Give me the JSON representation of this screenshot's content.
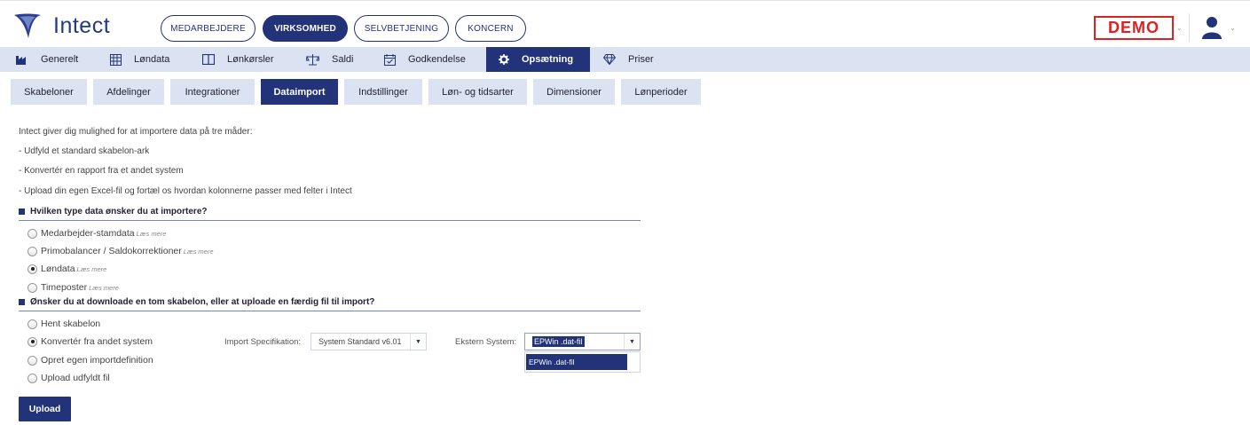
{
  "app": {
    "logo_text": "Intect"
  },
  "top_tabs": [
    {
      "label": "MEDARBEJDERE",
      "active": false
    },
    {
      "label": "VIRKSOMHED",
      "active": true
    },
    {
      "label": "SELVBETJENING",
      "active": false
    },
    {
      "label": "KONCERN",
      "active": false
    }
  ],
  "demo_badge": "DEMO",
  "main_nav": [
    {
      "label": "Generelt",
      "icon": "factory-icon"
    },
    {
      "label": "Løndata",
      "icon": "table-icon"
    },
    {
      "label": "Lønkørsler",
      "icon": "book-icon"
    },
    {
      "label": "Saldi",
      "icon": "scale-icon"
    },
    {
      "label": "Godkendelse",
      "icon": "calendar-check-icon"
    },
    {
      "label": "Opsætning",
      "icon": "gear-icon",
      "active": true
    },
    {
      "label": "Priser",
      "icon": "diamond-icon"
    }
  ],
  "sub_nav": [
    {
      "label": "Skabeloner"
    },
    {
      "label": "Afdelinger"
    },
    {
      "label": "Integrationer"
    },
    {
      "label": "Dataimport",
      "active": true
    },
    {
      "label": "Indstillinger"
    },
    {
      "label": "Løn- og tidsarter"
    },
    {
      "label": "Dimensioner"
    },
    {
      "label": "Lønperioder"
    }
  ],
  "intro": {
    "line1": "Intect giver dig mulighed for at importere data på tre måder:",
    "line2": "- Udfyld et standard skabelon-ark",
    "line3": "- Konvertér en rapport fra et andet system",
    "line4": "- Upload din egen Excel-fil og fortæl os hvordan kolonnerne passer med felter i Intect"
  },
  "section1": {
    "title": "Hvilken type data ønsker du at importere?",
    "options": [
      {
        "label": "Medarbejder-stamdata",
        "link": "Læs mere",
        "checked": false
      },
      {
        "label": "Primobalancer / Saldokorrektioner",
        "link": "Læs mere",
        "checked": false
      },
      {
        "label": "Løndata",
        "link": "Læs mere",
        "checked": true
      },
      {
        "label": "Timeposter",
        "link": "Læs mere",
        "checked": false
      }
    ]
  },
  "section2": {
    "title": "Ønsker du at downloade en tom skabelon, eller at uploade en færdig fil til import?",
    "options": [
      {
        "label": "Hent skabelon",
        "checked": false
      },
      {
        "label": "Konvertér fra andet system",
        "checked": true
      },
      {
        "label": "Opret egen importdefinition",
        "checked": false
      },
      {
        "label": "Upload udfyldt fil",
        "checked": false
      }
    ]
  },
  "import_spec": {
    "label": "Import Specifikation:",
    "value": "System Standard v6.01"
  },
  "external_system": {
    "label": "Ekstern System:",
    "value": "EPWin .dat-fil",
    "options": [
      "EPWin .dat-fil"
    ]
  },
  "upload_label": "Upload"
}
